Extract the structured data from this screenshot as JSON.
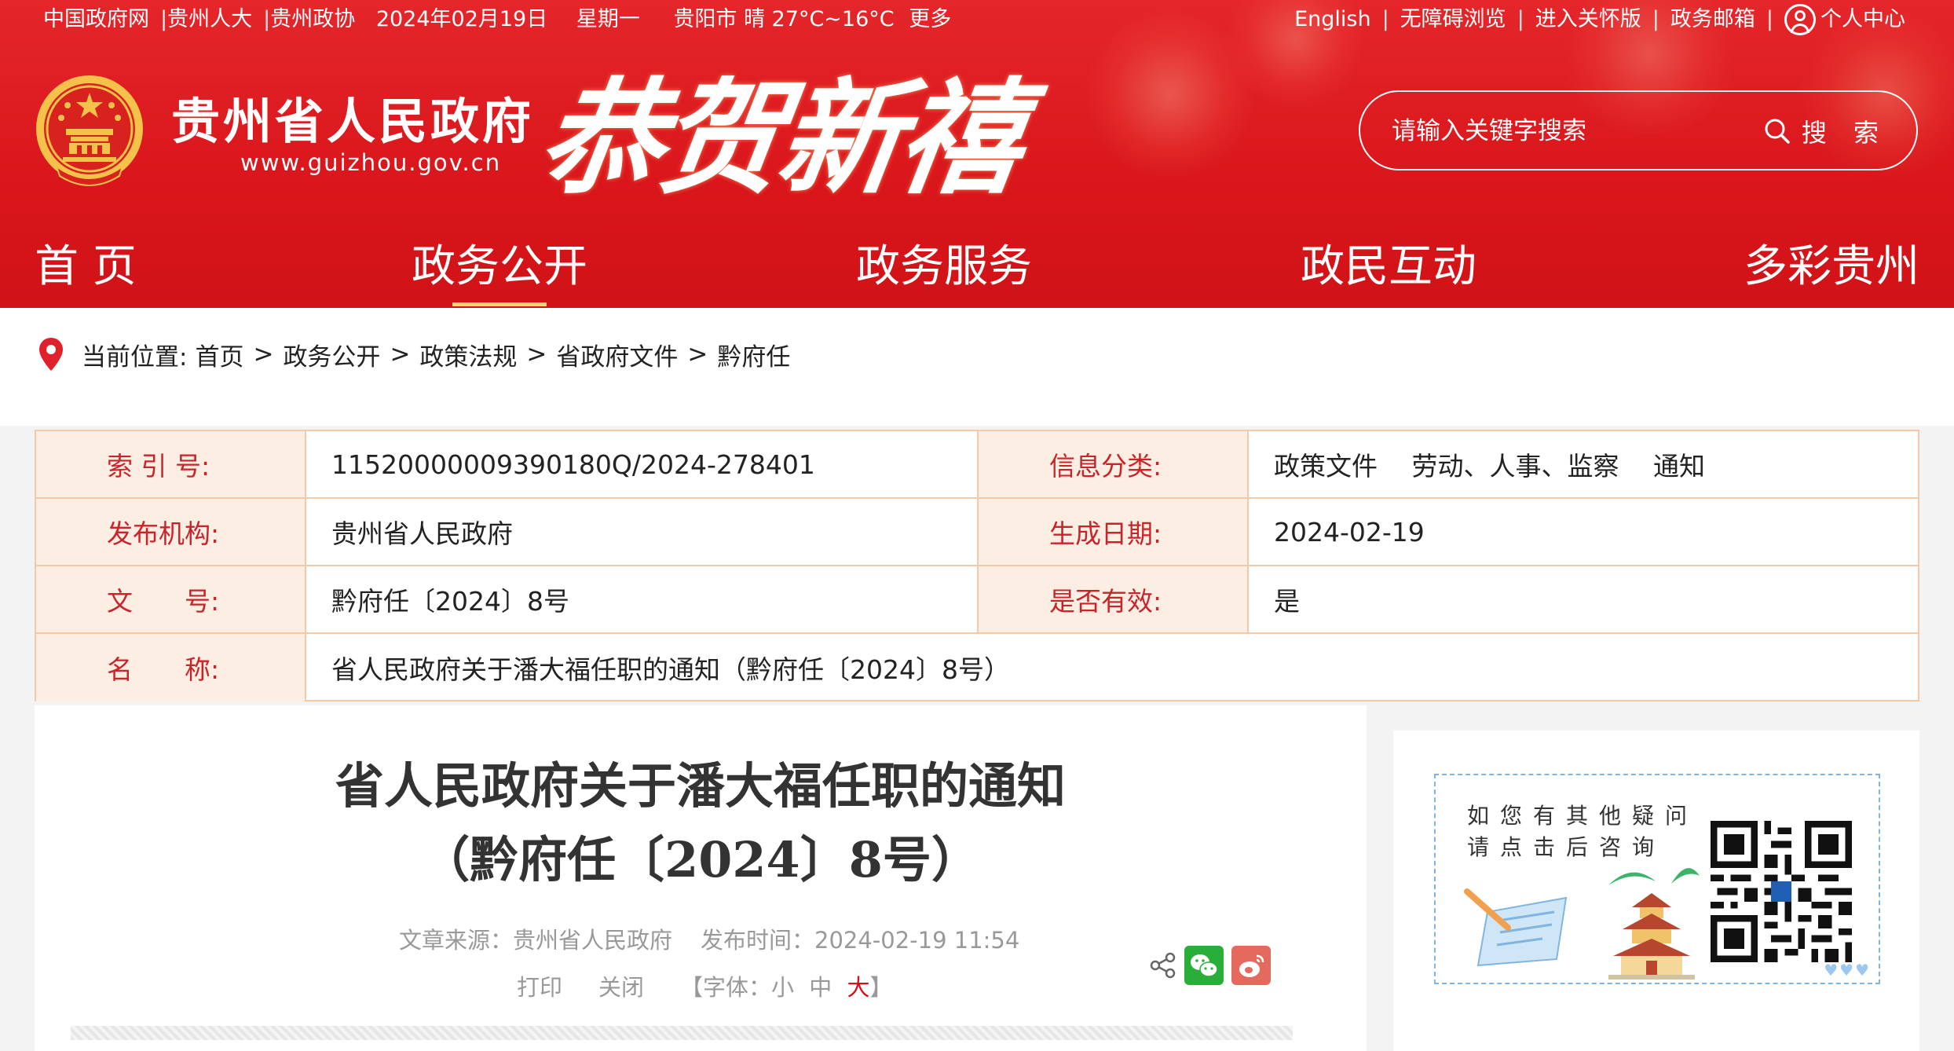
{
  "topbar": {
    "links": [
      "中国政府网",
      "贵州人大",
      "贵州政协"
    ],
    "date": "2024年02月19日",
    "weekday": "星期一",
    "weather": "贵阳市 晴 27°C~16°C",
    "more": "更多",
    "right_links": [
      "English",
      "无障碍浏览",
      "进入关怀版",
      "政务邮箱"
    ],
    "user_center": "个人中心"
  },
  "header": {
    "site_name": "贵州省人民政府",
    "site_url": "www.guizhou.gov.cn",
    "banner": "恭贺新禧",
    "search_placeholder": "请输入关键字搜索",
    "search_button": "搜 索"
  },
  "nav": {
    "items": [
      "首 页",
      "政务公开",
      "政务服务",
      "政民互动",
      "多彩贵州"
    ],
    "active": "政务公开"
  },
  "breadcrumb": {
    "label": "当前位置:",
    "items": [
      "首页",
      "政务公开",
      "政策法规",
      "省政府文件",
      "黔府任"
    ]
  },
  "meta": {
    "index_label": "索 引 号:",
    "index_value": "11520000009390180Q/2024-278401",
    "category_label": "信息分类:",
    "category_value": "政策文件　 劳动、人事、监察　 通知",
    "publisher_label": "发布机构:",
    "publisher_value": "贵州省人民政府",
    "date_label": "生成日期:",
    "date_value": "2024-02-19",
    "docno_label": "文　　号:",
    "docno_value": "黔府任〔2024〕8号",
    "valid_label": "是否有效:",
    "valid_value": "是",
    "name_label": "名　　称:",
    "name_value": "省人民政府关于潘大福任职的通知（黔府任〔2024〕8号）"
  },
  "article": {
    "title_line1": "省人民政府关于潘大福任职的通知",
    "title_line2": "（黔府任〔2024〕8号）",
    "source": "文章来源：贵州省人民政府",
    "publish_time": "发布时间：2024-02-19 11:54",
    "print": "打印",
    "close": "关闭",
    "font_prefix": "【字体：",
    "font_small": "小",
    "font_medium": "中",
    "font_large": "大",
    "font_suffix": "】"
  },
  "sidebar": {
    "line1": "如您有其他疑问",
    "line2": "请点击后咨询"
  },
  "colors": {
    "header_red": "#d9161b",
    "label_red": "#c8242a",
    "label_bg": "#fdeee3",
    "border": "#f3c9a8",
    "accent_gold": "#f9d27a"
  }
}
